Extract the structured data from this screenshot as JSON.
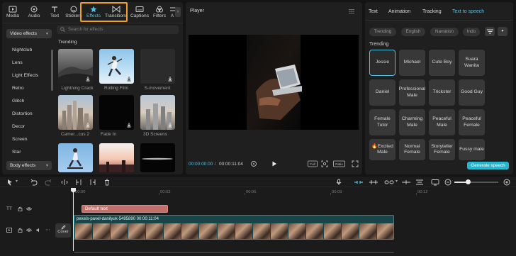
{
  "toolbar": {
    "items": [
      {
        "label": "Media",
        "icon": "media-icon"
      },
      {
        "label": "Audio",
        "icon": "audio-icon"
      },
      {
        "label": "Text",
        "icon": "text-icon"
      },
      {
        "label": "Stickers",
        "icon": "stickers-icon"
      },
      {
        "label": "Effects",
        "icon": "effects-icon",
        "active": true
      },
      {
        "label": "Transitions",
        "icon": "transitions-icon"
      },
      {
        "label": "Captions",
        "icon": "captions-icon"
      },
      {
        "label": "Filters",
        "icon": "filters-icon"
      },
      {
        "label": "A",
        "icon": "adjust-icon"
      }
    ],
    "more_arrow": "›"
  },
  "effects_panel": {
    "video_effects_dropdown": "Video effects",
    "categories": [
      "Nightclub",
      "Lens",
      "Light Effects",
      "Retro",
      "Glitch",
      "Distortion",
      "Decor",
      "Screen",
      "Star"
    ],
    "body_effects_dropdown": "Body effects",
    "search_placeholder": "Search for effects",
    "section_title": "Trending",
    "thumbnails": [
      {
        "label": "Lightning Crack"
      },
      {
        "label": "Rolling Film"
      },
      {
        "label": "S-movement"
      },
      {
        "label": "Camer...cus 2"
      },
      {
        "label": "Fade In"
      },
      {
        "label": "3D Screens"
      },
      {
        "label": ""
      },
      {
        "label": ""
      },
      {
        "label": ""
      }
    ]
  },
  "player": {
    "title": "Player",
    "time_current": "00:00:00:00",
    "time_separator": "/",
    "time_total": "00:00:11:04",
    "full_label": "Full",
    "ratio_label": "Ratio"
  },
  "right_panel": {
    "tabs": [
      "Text",
      "Animation",
      "Tracking",
      "Text to speech"
    ],
    "active_tab": "Text to speech",
    "filters": [
      "Trending",
      "English",
      "Narration",
      "Indo"
    ],
    "voice_section": "Trending",
    "voices": [
      "Jessie",
      "Michael",
      "Cute Boy",
      "Suara Wanita",
      "Daniel",
      "Professional Male",
      "Trickster",
      "Good Guy",
      "Female Tutor",
      "Charming Male",
      "Peaceful Male",
      "Peaceful Female",
      "🔥Excited Male",
      "Normal Female",
      "Storyteller Female",
      "Fussy male"
    ],
    "generate_button": "Generate speech"
  },
  "timeline": {
    "ruler": [
      "00:00",
      "00:03",
      "00:06",
      "00:09",
      "00:12"
    ],
    "text_clip": "Default text",
    "video_clip": "pexels-pavel-danilyuk-5495890   00:00:11:04",
    "cover_label": "Cover",
    "zoom_level": 0.3
  },
  "colors": {
    "accent": "#4fc3e6",
    "highlight": "#f2a223",
    "text_clip": "#c0706a",
    "video_clip": "#1a4548",
    "generate": "#26b5cc"
  }
}
